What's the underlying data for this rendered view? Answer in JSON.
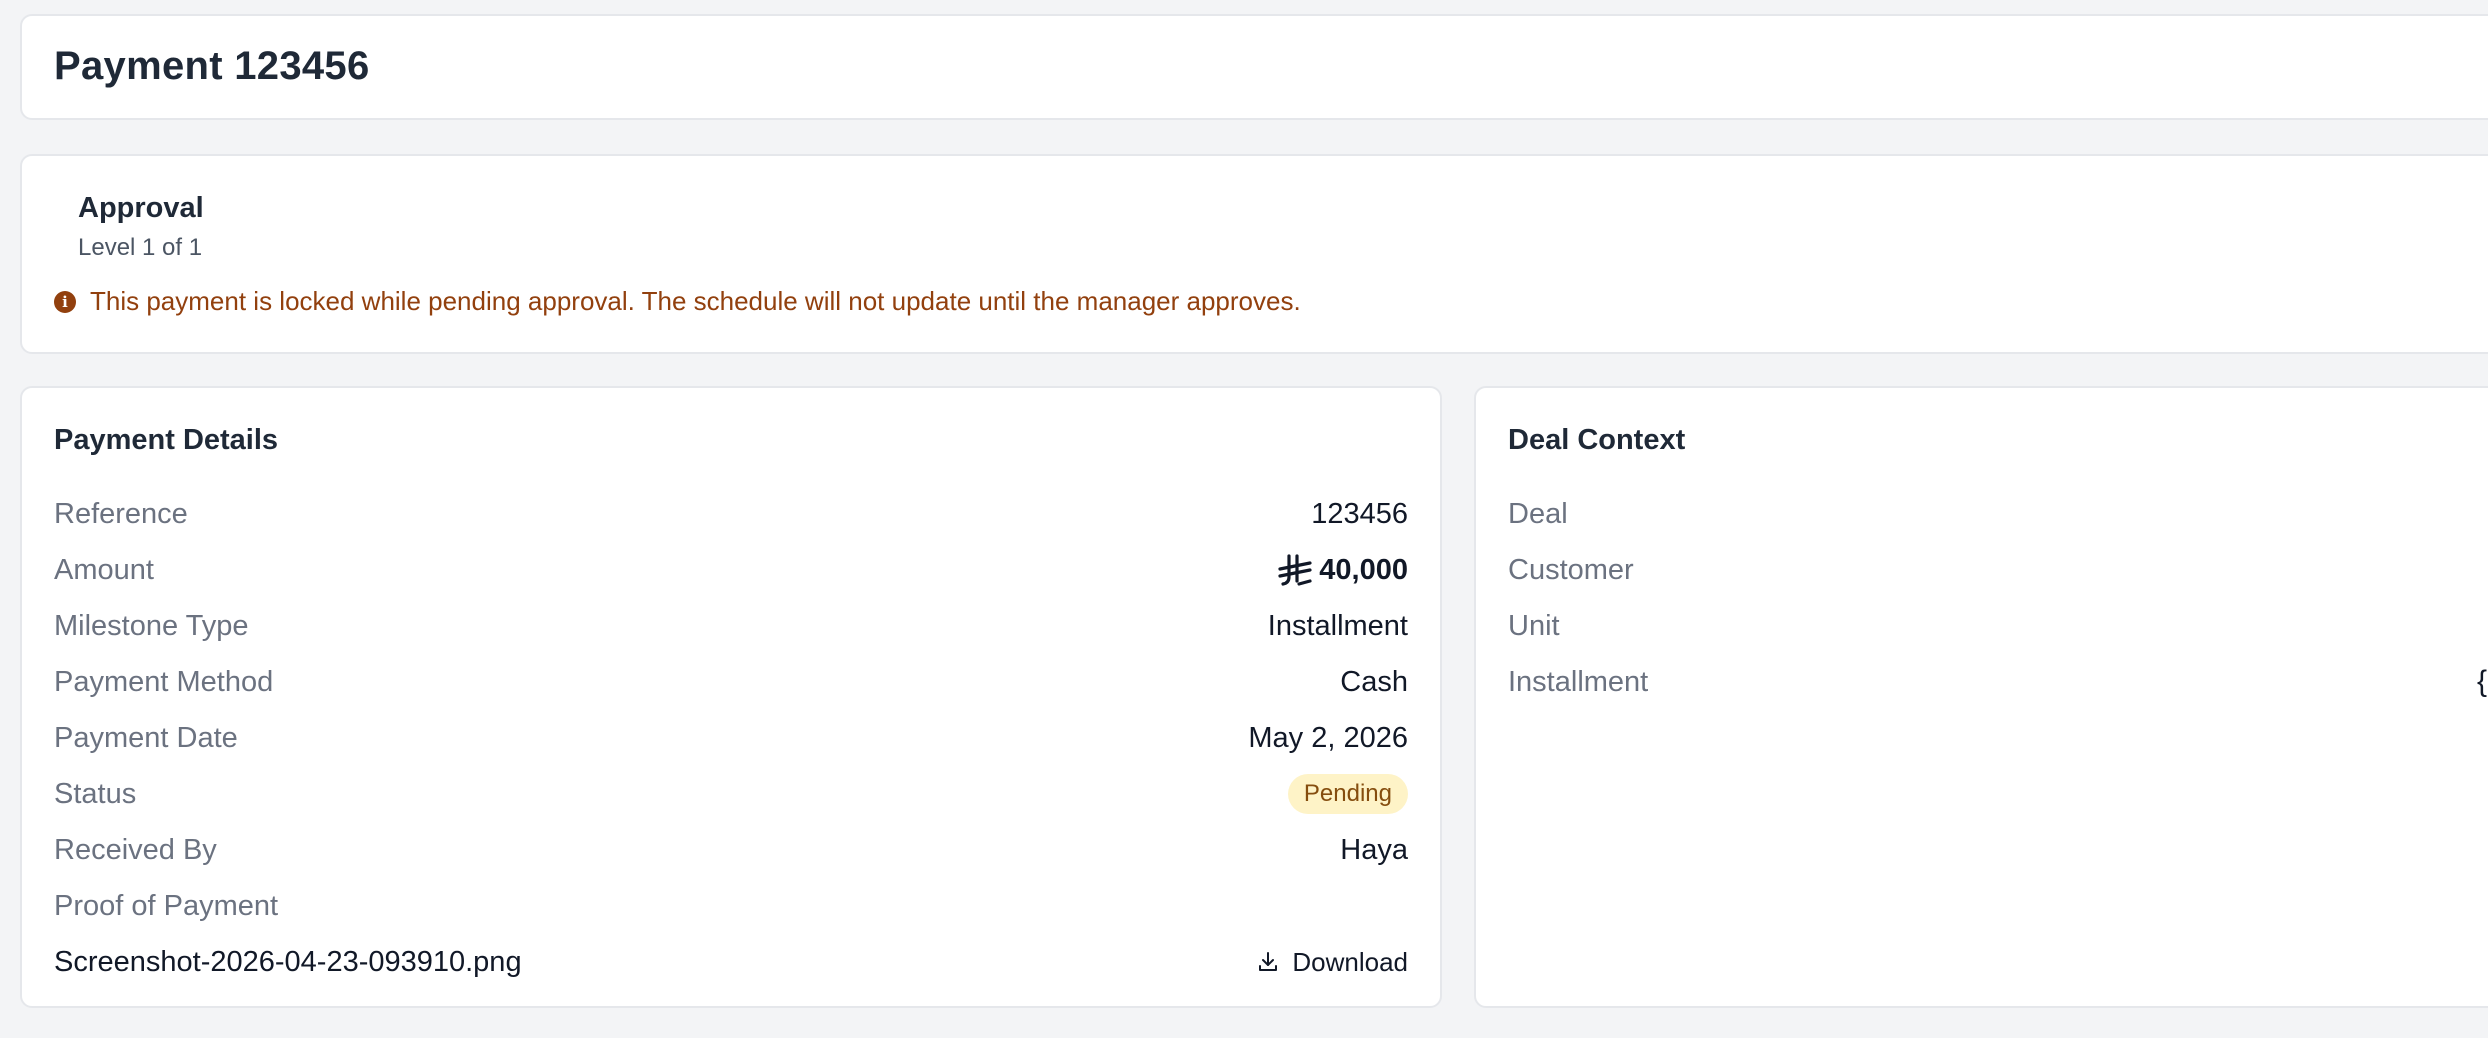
{
  "header": {
    "title": "Payment 123456"
  },
  "approval": {
    "title": "Approval",
    "level": "Level 1 of 1",
    "warning": "This payment is locked while pending approval. The schedule will not update until the manager approves.",
    "warning_color": "#92400e"
  },
  "payment_details": {
    "title": "Payment Details",
    "rows": [
      {
        "label": "Reference",
        "value": "123456"
      },
      {
        "label": "Amount",
        "value": "40,000",
        "currency_icon": "saudi-riyal-icon"
      },
      {
        "label": "Milestone Type",
        "value": "Installment"
      },
      {
        "label": "Payment Method",
        "value": "Cash"
      },
      {
        "label": "Payment Date",
        "value": "May 2, 2026"
      },
      {
        "label": "Status",
        "value": "Pending",
        "badge_color": "#fef3c7"
      },
      {
        "label": "Received By",
        "value": "Haya"
      },
      {
        "label": "Proof of Payment",
        "value": ""
      }
    ],
    "file": {
      "name": "Screenshot-2026-04-23-093910.png",
      "action": "Download",
      "icon": "download-icon"
    }
  },
  "deal_context": {
    "title": "Deal Context",
    "rows": [
      {
        "label": "Deal",
        "value": ""
      },
      {
        "label": "Customer",
        "value": ""
      },
      {
        "label": "Unit",
        "value": ""
      },
      {
        "label": "Installment",
        "value": "{"
      }
    ]
  }
}
